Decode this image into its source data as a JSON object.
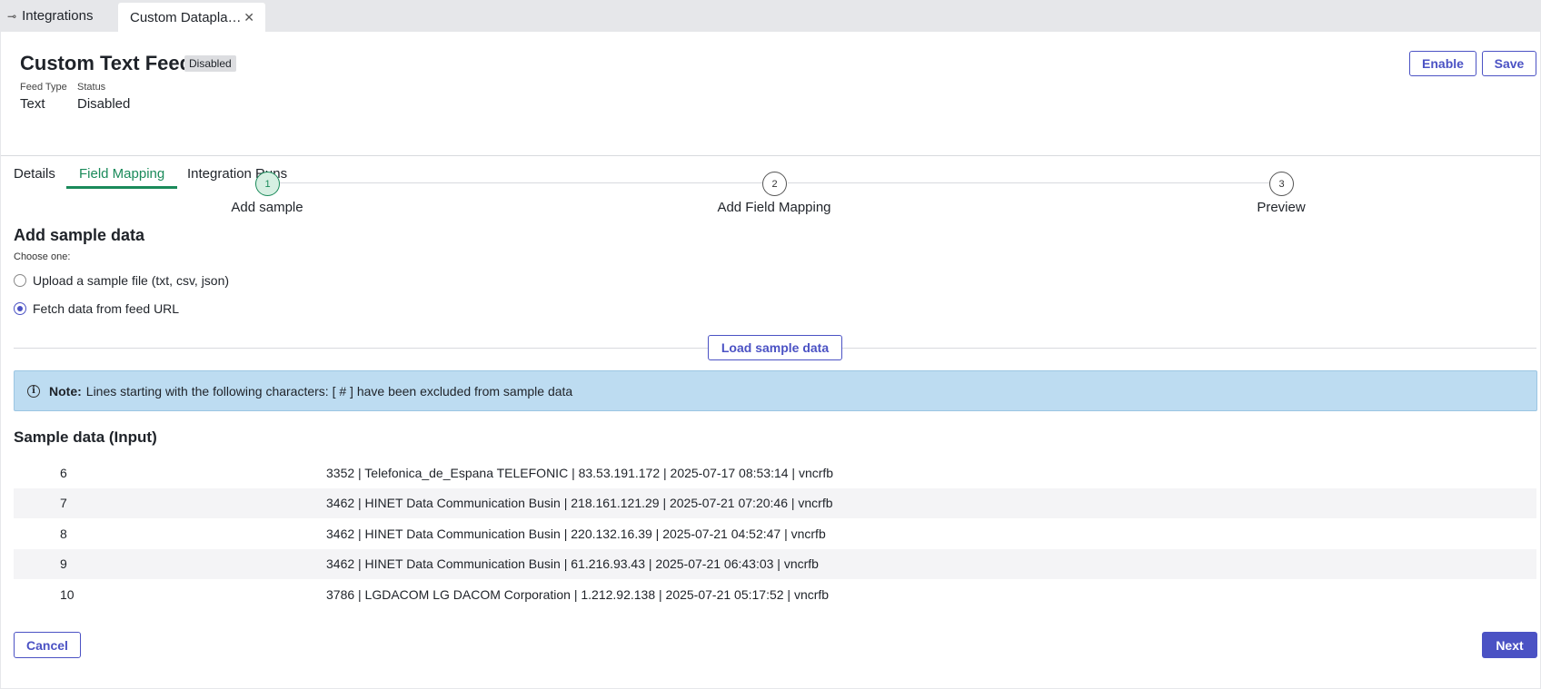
{
  "window_tabs": [
    {
      "icon": "integrations-icon",
      "label": "Integrations"
    },
    {
      "label": "Custom Datapla…",
      "close_icon": "close-icon"
    }
  ],
  "header": {
    "title": "Custom Text Feed",
    "badge": "Disabled",
    "feed_type_label": "Feed Type",
    "feed_type_value": "Text",
    "status_label": "Status",
    "status_value": "Disabled",
    "enable_label": "Enable",
    "save_label": "Save"
  },
  "tabs": [
    {
      "label": "Details"
    },
    {
      "label": "Field Mapping",
      "active": true
    },
    {
      "label": "Integration Runs"
    }
  ],
  "stepper": [
    {
      "number": "1",
      "label": "Add sample",
      "current": true
    },
    {
      "number": "2",
      "label": "Add Field Mapping"
    },
    {
      "number": "3",
      "label": "Preview"
    }
  ],
  "sample_section": {
    "title": "Add sample data",
    "choose_label": "Choose one:",
    "options": [
      {
        "label": "Upload a sample file (txt, csv, json)",
        "checked": false
      },
      {
        "label": "Fetch data from feed URL",
        "checked": true
      }
    ],
    "load_button": "Load sample data"
  },
  "note": {
    "bold": "Note:",
    "text": "Lines starting with the following characters: [ # ] have been excluded from sample data"
  },
  "sample_input": {
    "title": "Sample data (Input)",
    "rows": [
      {
        "line": "6",
        "value": "3352 | Telefonica_de_Espana TELEFONIC | 83.53.191.172 | 2025-07-17 08:53:14 | vncrfb"
      },
      {
        "line": "7",
        "value": "3462 | HINET Data Communication Busin | 218.161.121.29 | 2025-07-21 07:20:46 | vncrfb"
      },
      {
        "line": "8",
        "value": "3462 | HINET Data Communication Busin | 220.132.16.39 | 2025-07-21 04:52:47 | vncrfb"
      },
      {
        "line": "9",
        "value": "3462 | HINET Data Communication Busin | 61.216.93.43 | 2025-07-21 06:43:03 | vncrfb"
      },
      {
        "line": "10",
        "value": "3786 | LGDACOM LG DACOM Corporation | 1.212.92.138 | 2025-07-21 05:17:52 | vncrfb"
      }
    ]
  },
  "footer": {
    "cancel_label": "Cancel",
    "next_label": "Next"
  },
  "colors": {
    "accent": "#4b52c4",
    "active_tab": "#1a8a5a",
    "note_bg": "#bddcf1"
  }
}
